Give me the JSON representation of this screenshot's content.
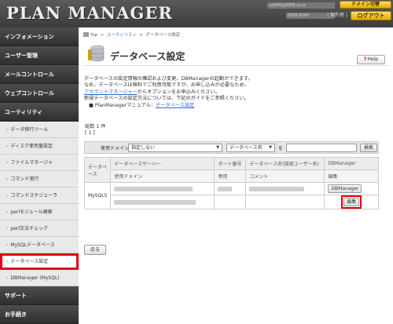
{
  "header": {
    "logo": "PLAN MANAGER",
    "account_placeholder": "ua888@8888.ne.jp",
    "id_placeholder": "8888-8888",
    "domain_switch": "ドメイン切替",
    "contract": "| 契約者 |",
    "logout": "ログアウト"
  },
  "sidebar": {
    "sections": {
      "info": "インフォメーション",
      "users": "ユーザー管理",
      "mail": "メールコントロール",
      "web": "ウェブコントロール",
      "utility": "ユーティリティ",
      "support": "サポート",
      "procedures": "お手続き"
    },
    "items": [
      "データ移行ツール",
      "ディスク使用量設定",
      "ファイルマネージャ",
      "コマンド実行",
      "コマンドスケジューラ",
      "perlモジュール検索",
      "perl文法チェック",
      "MySQLデータベース",
      "データベース設定",
      "DBManager (MySQL)"
    ]
  },
  "breadcrumb": {
    "home": "Top",
    "sep": ">",
    "utility": "ユーティリティ",
    "current": "データベース設定"
  },
  "page": {
    "title": "データベース設定",
    "help": "Help"
  },
  "description": {
    "line1": "データベースの設定情報の確認および変更、DBManagerの起動ができます。",
    "line2": "なお、データベースは無料でご利用可能ですが、お申し込みが必要なため、",
    "line3_link": "アカウントマネージャー",
    "line3_rest": "からオプションをお申込みください。",
    "line4": "新規データベースの設定方法については、下記のガイドをご参照ください。",
    "manual_prefix": "■ PlanManagerマニュアル：",
    "manual_link": "データベース設定"
  },
  "results": {
    "total": "総数 1 件",
    "pager": "[ 1 ]"
  },
  "search": {
    "domain_label": "使用ドメイン",
    "domain_value": "指定しない",
    "field_value": "データベース名",
    "wo": "を",
    "button": "検索"
  },
  "table": {
    "headers": {
      "type": "データベース",
      "server": "データベースサーバー",
      "port": "ポート番号",
      "dbname": "データベース名(接続ユーザー名)",
      "dbmanager": "DBManager",
      "domain": "使用ドメイン",
      "purpose": "専用",
      "comment": "コメント",
      "edit": "編集"
    },
    "row": {
      "type": "MySQL5",
      "dbmanager_btn": "DBManager",
      "edit_btn": "編集"
    }
  },
  "back_button": "戻る",
  "colors": {
    "highlight": "#e40012",
    "header_bg": "#3c3c3c",
    "button_yellow": "#e6a800",
    "link": "#3366cc"
  }
}
